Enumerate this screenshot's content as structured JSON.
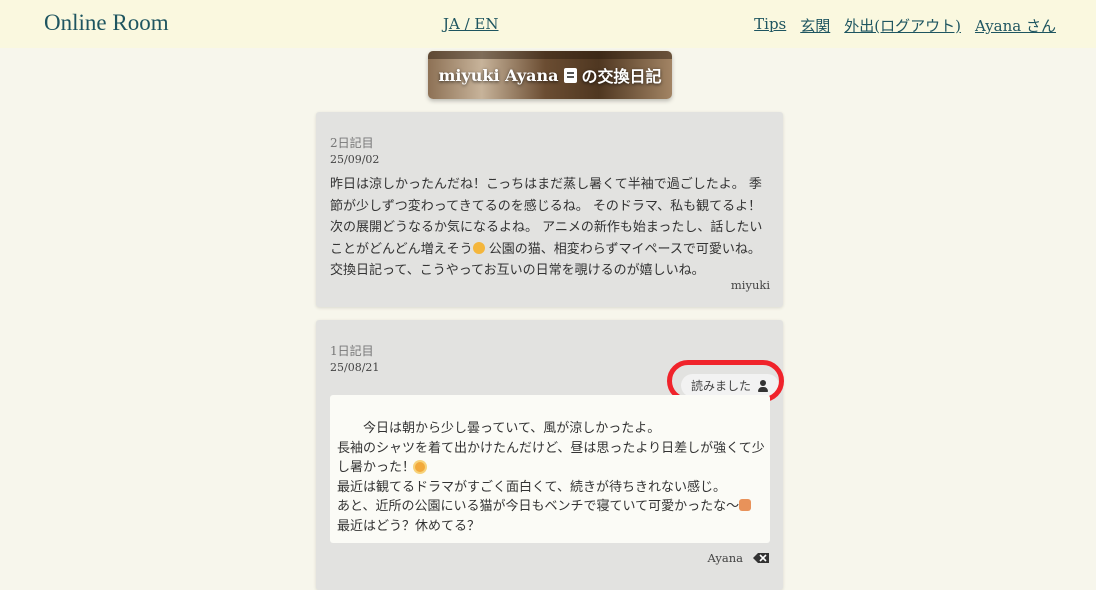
{
  "header": {
    "brand": "Online Room",
    "lang": "JA / EN",
    "nav": [
      "Tips",
      "玄関",
      "外出(ログアウト)",
      "Ayana さん"
    ]
  },
  "banner": {
    "title_part1": "miyuki Ayana",
    "title_part2": "の交換日記"
  },
  "entries": [
    {
      "day": "2日記目",
      "date": "25/09/02",
      "text_a": "昨日は涼しかったんだね！こっちはまだ蒸し暑くて半袖で過ごしたよ。 季節が少しずつ変わってきてるのを感じるね。 そのドラマ、私も観てるよ！次の展開どうなるか気になるよね。 アニメの新作も始まったし、話したいことがどんどん増えそう",
      "text_b": " 公園の猫、相変わらずマイペースで可愛いね。交換日記って、こうやってお互いの日常を覗けるのが嬉しいね。",
      "author": "miyuki"
    },
    {
      "day": "1日記目",
      "date": "25/08/21",
      "read_label": "読みました",
      "line1": "　　今日は朝から少し曇っていて、風が涼しかったよ。",
      "line2": "長袖のシャツを着て出かけたんだけど、昼は思ったより日差しが強くて少し暑かった！",
      "line3": "最近は観てるドラマがすごく面白くて、続きが待ちきれない感じ。",
      "line4": "あと、近所の公園にいる猫が今日もベンチで寝ていて可愛かったな〜",
      "line5": "最近はどう？休めてる？",
      "author": "Ayana"
    }
  ],
  "colors": {
    "accent": "#1e5560",
    "highlight": "#f0232b",
    "background": "#f7f6ec"
  }
}
